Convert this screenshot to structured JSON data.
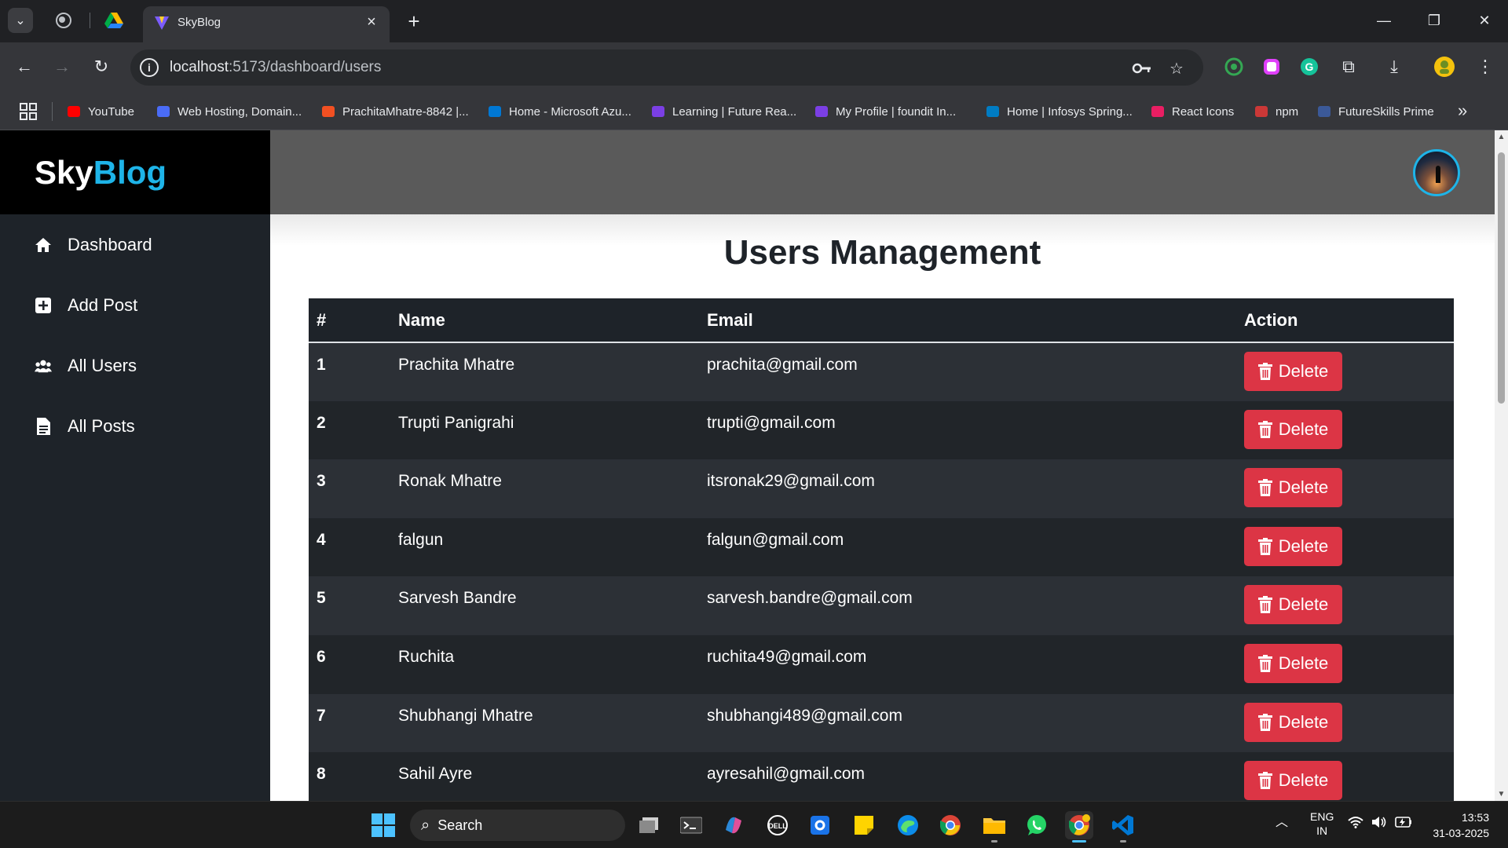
{
  "browser": {
    "tab_title": "SkyBlog",
    "url_host": "localhost",
    "url_path": ":5173/dashboard/users",
    "bookmarks": [
      {
        "label": "YouTube",
        "icon": "youtube-icon",
        "color": "#ff0000"
      },
      {
        "label": "Web Hosting, Domain...",
        "icon": "grid-favicon-icon",
        "color": "#4a6cf7"
      },
      {
        "label": "PrachitaMhatre-8842 |...",
        "icon": "microsoft-icon",
        "color": "#f25022"
      },
      {
        "label": "Home - Microsoft Azu...",
        "icon": "azure-icon",
        "color": "#0078d4"
      },
      {
        "label": "Learning | Future Rea...",
        "icon": "check-swoosh-icon",
        "color": "#7b3fe4"
      },
      {
        "label": "My Profile | foundit In...",
        "icon": "check-swoosh-icon",
        "color": "#7b3fe4"
      },
      {
        "label": "Home | Infosys Spring...",
        "icon": "infosys-icon",
        "color": "#007cc3"
      },
      {
        "label": "React Icons",
        "icon": "react-icon",
        "color": "#e91e63"
      },
      {
        "label": "npm",
        "icon": "npm-icon",
        "color": "#cb3837"
      },
      {
        "label": "FutureSkills Prime",
        "icon": "futureskills-icon",
        "color": "#3b5998"
      }
    ]
  },
  "app": {
    "brand_part1": "Sky",
    "brand_part2": "Blog",
    "brand_color": "#1eb4e8",
    "sidebar": [
      {
        "label": "Dashboard",
        "icon": "home-icon"
      },
      {
        "label": "Add Post",
        "icon": "plus-square-icon"
      },
      {
        "label": "All Users",
        "icon": "users-icon"
      },
      {
        "label": "All Posts",
        "icon": "file-icon"
      }
    ]
  },
  "main": {
    "title": "Users Management",
    "columns": [
      "#",
      "Name",
      "Email",
      "Action"
    ],
    "delete_label": "Delete",
    "delete_color": "#dc3545",
    "rows": [
      {
        "num": "1",
        "name": "Prachita Mhatre",
        "email": "prachita@gmail.com"
      },
      {
        "num": "2",
        "name": "Trupti Panigrahi",
        "email": "trupti@gmail.com"
      },
      {
        "num": "3",
        "name": "Ronak Mhatre",
        "email": "itsronak29@gmail.com"
      },
      {
        "num": "4",
        "name": "falgun",
        "email": "falgun@gmail.com"
      },
      {
        "num": "5",
        "name": "Sarvesh Bandre",
        "email": "sarvesh.bandre@gmail.com"
      },
      {
        "num": "6",
        "name": "Ruchita",
        "email": "ruchita49@gmail.com"
      },
      {
        "num": "7",
        "name": "Shubhangi Mhatre",
        "email": "shubhangi489@gmail.com"
      },
      {
        "num": "8",
        "name": "Sahil Ayre",
        "email": "ayresahil@gmail.com"
      }
    ]
  },
  "taskbar": {
    "search_label": "Search",
    "lang_line1": "ENG",
    "lang_line2": "IN",
    "time": "13:53",
    "date": "31-03-2025"
  }
}
